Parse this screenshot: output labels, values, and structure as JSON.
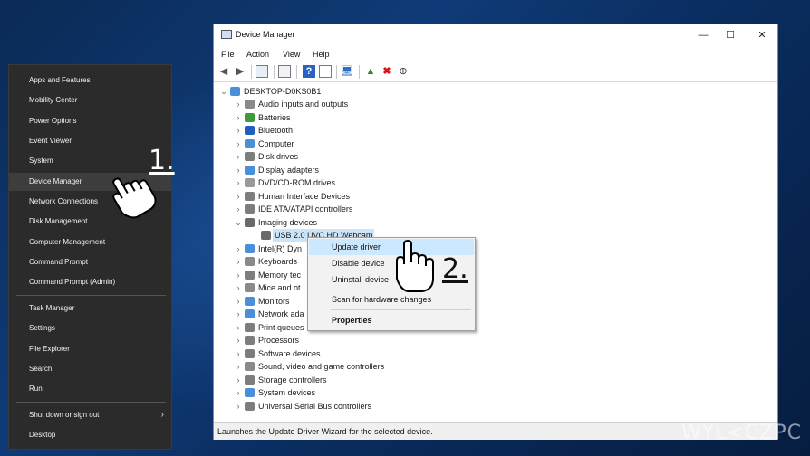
{
  "winx_menu": {
    "items": [
      {
        "label": "Apps and Features"
      },
      {
        "label": "Mobility Center"
      },
      {
        "label": "Power Options"
      },
      {
        "label": "Event Viewer"
      },
      {
        "label": "System"
      },
      {
        "label": "Device Manager",
        "selected": true
      },
      {
        "label": "Network Connections"
      },
      {
        "label": "Disk Management"
      },
      {
        "label": "Computer Management"
      },
      {
        "label": "Command Prompt"
      },
      {
        "label": "Command Prompt (Admin)"
      },
      {
        "label": "Task Manager"
      },
      {
        "label": "Settings"
      },
      {
        "label": "File Explorer"
      },
      {
        "label": "Search"
      },
      {
        "label": "Run"
      },
      {
        "label": "Shut down or sign out",
        "submenu": true
      },
      {
        "label": "Desktop"
      }
    ]
  },
  "device_manager": {
    "title": "Device Manager",
    "window_buttons": {
      "minimize": "—",
      "maximize": "☐",
      "close": "✕"
    },
    "menu": [
      "File",
      "Action",
      "View",
      "Help"
    ],
    "root": "DESKTOP-D0KS0B1",
    "tree": [
      {
        "label": "Audio inputs and outputs",
        "icon": "speaker-icon",
        "color": "#8a8a8a"
      },
      {
        "label": "Batteries",
        "icon": "battery-icon",
        "color": "#3d9b3d"
      },
      {
        "label": "Bluetooth",
        "icon": "bluetooth-icon",
        "color": "#1f5fbf"
      },
      {
        "label": "Computer",
        "icon": "computer-icon",
        "color": "#4a90d9"
      },
      {
        "label": "Disk drives",
        "icon": "disk-icon",
        "color": "#7d7d7d"
      },
      {
        "label": "Display adapters",
        "icon": "display-icon",
        "color": "#4a90d9"
      },
      {
        "label": "DVD/CD-ROM drives",
        "icon": "dvd-icon",
        "color": "#9a9a9a"
      },
      {
        "label": "Human Interface Devices",
        "icon": "hid-icon",
        "color": "#7d7d7d"
      },
      {
        "label": "IDE ATA/ATAPI controllers",
        "icon": "ide-icon",
        "color": "#7d7d7d"
      },
      {
        "label": "Imaging devices",
        "icon": "camera-icon",
        "color": "#6a6a6a",
        "expanded": true
      },
      {
        "label": "USB 2.0 UVC HD Webcam",
        "icon": "webcam-icon",
        "color": "#6a6a6a",
        "child": true,
        "selected": true
      },
      {
        "label": "Intel(R) Dyn",
        "icon": "chip-icon",
        "color": "#4a90d9"
      },
      {
        "label": "Keyboards",
        "icon": "keyboard-icon",
        "color": "#8a8a8a"
      },
      {
        "label": "Memory tec",
        "icon": "memory-icon",
        "color": "#7d7d7d"
      },
      {
        "label": "Mice and ot",
        "icon": "mouse-icon",
        "color": "#8a8a8a"
      },
      {
        "label": "Monitors",
        "icon": "monitor-icon",
        "color": "#4a90d9"
      },
      {
        "label": "Network ada",
        "icon": "network-icon",
        "color": "#4a90d9"
      },
      {
        "label": "Print queues",
        "icon": "printer-icon",
        "color": "#7d7d7d"
      },
      {
        "label": "Processors",
        "icon": "processor-icon",
        "color": "#7d7d7d"
      },
      {
        "label": "Software devices",
        "icon": "software-icon",
        "color": "#7d7d7d"
      },
      {
        "label": "Sound, video and game controllers",
        "icon": "sound-icon",
        "color": "#8a8a8a"
      },
      {
        "label": "Storage controllers",
        "icon": "storage-icon",
        "color": "#7d7d7d"
      },
      {
        "label": "System devices",
        "icon": "system-icon",
        "color": "#4a90d9"
      },
      {
        "label": "Universal Serial Bus controllers",
        "icon": "usb-icon",
        "color": "#7d7d7d"
      }
    ],
    "status": "Launches the Update Driver Wizard for the selected device."
  },
  "context_menu": {
    "items": [
      {
        "label": "Update driver"
      },
      {
        "label": "Disable device"
      },
      {
        "label": "Uninstall device"
      },
      {
        "label": "Scan for hardware changes"
      },
      {
        "label": "Properties"
      }
    ]
  },
  "steps": {
    "one": "1.",
    "two": "2."
  },
  "watermark": "WYL<CZPC"
}
